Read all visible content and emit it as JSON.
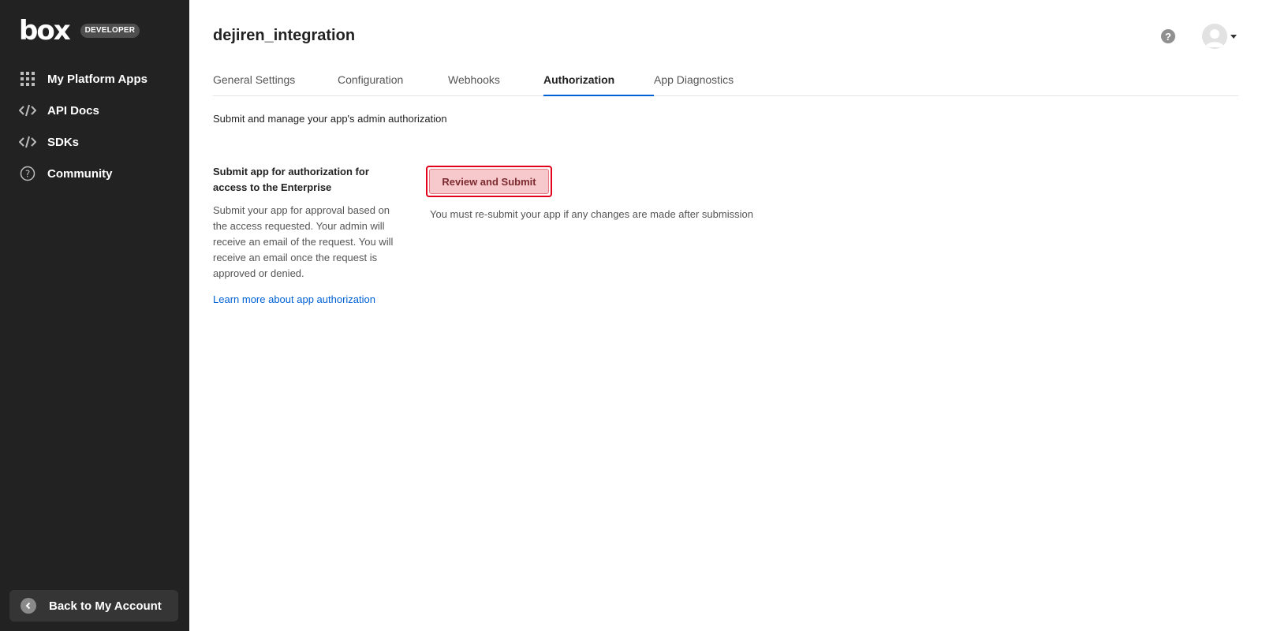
{
  "brand": {
    "logo": "box",
    "badge": "DEVELOPER"
  },
  "sidebar": {
    "items": [
      {
        "label": "My Platform Apps",
        "icon": "grid-icon"
      },
      {
        "label": "API Docs",
        "icon": "code-icon"
      },
      {
        "label": "SDKs",
        "icon": "code-icon"
      },
      {
        "label": "Community",
        "icon": "question-circle-icon"
      }
    ],
    "back": {
      "label": "Back to My Account",
      "icon": "chevron-left-icon"
    }
  },
  "header": {
    "title": "dejiren_integration",
    "help_icon": "?"
  },
  "tabs": [
    {
      "label": "General Settings",
      "active": false
    },
    {
      "label": "Configuration",
      "active": false
    },
    {
      "label": "Webhooks",
      "active": false
    },
    {
      "label": "Authorization",
      "active": true
    },
    {
      "label": "App Diagnostics",
      "active": false
    }
  ],
  "main": {
    "subtitle": "Submit and manage your app's admin authorization",
    "section": {
      "title": "Submit app for authorization for access to the Enterprise",
      "description": "Submit your app for approval based on the access requested. Your admin will receive an email of the request. You will receive an email once the request is approved or denied.",
      "link": "Learn more about app authorization"
    },
    "submit_button": "Review and Submit",
    "note": "You must re-submit your app if any changes are made after submission"
  },
  "colors": {
    "sidebar_bg": "#222222",
    "accent": "#0061d5",
    "highlight": "#e3001b"
  }
}
